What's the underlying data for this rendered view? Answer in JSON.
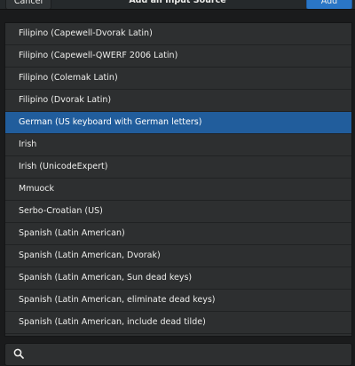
{
  "header": {
    "cancel_label": "Cancel",
    "title": "Add an Input Source",
    "add_label": "Add"
  },
  "list": {
    "selected_index": 4,
    "items": [
      {
        "label": "Filipino (Capewell-Dvorak Latin)"
      },
      {
        "label": "Filipino (Capewell-QWERF 2006 Latin)"
      },
      {
        "label": "Filipino (Colemak Latin)"
      },
      {
        "label": "Filipino (Dvorak Latin)"
      },
      {
        "label": "German (US keyboard with German letters)"
      },
      {
        "label": "Irish"
      },
      {
        "label": "Irish (UnicodeExpert)"
      },
      {
        "label": "Mmuock"
      },
      {
        "label": "Serbo-Croatian (US)"
      },
      {
        "label": "Spanish (Latin American)"
      },
      {
        "label": "Spanish (Latin American, Dvorak)"
      },
      {
        "label": "Spanish (Latin American, Sun dead keys)"
      },
      {
        "label": "Spanish (Latin American, eliminate dead keys)"
      },
      {
        "label": "Spanish (Latin American, include dead tilde)"
      }
    ]
  },
  "search": {
    "icon": "search-icon",
    "value": ""
  },
  "colors": {
    "background": "#1a1b1c",
    "list_background": "#2d2f30",
    "selected_row": "#215d9c",
    "accent_button": "#2a76c6",
    "text": "#eeeeec"
  }
}
